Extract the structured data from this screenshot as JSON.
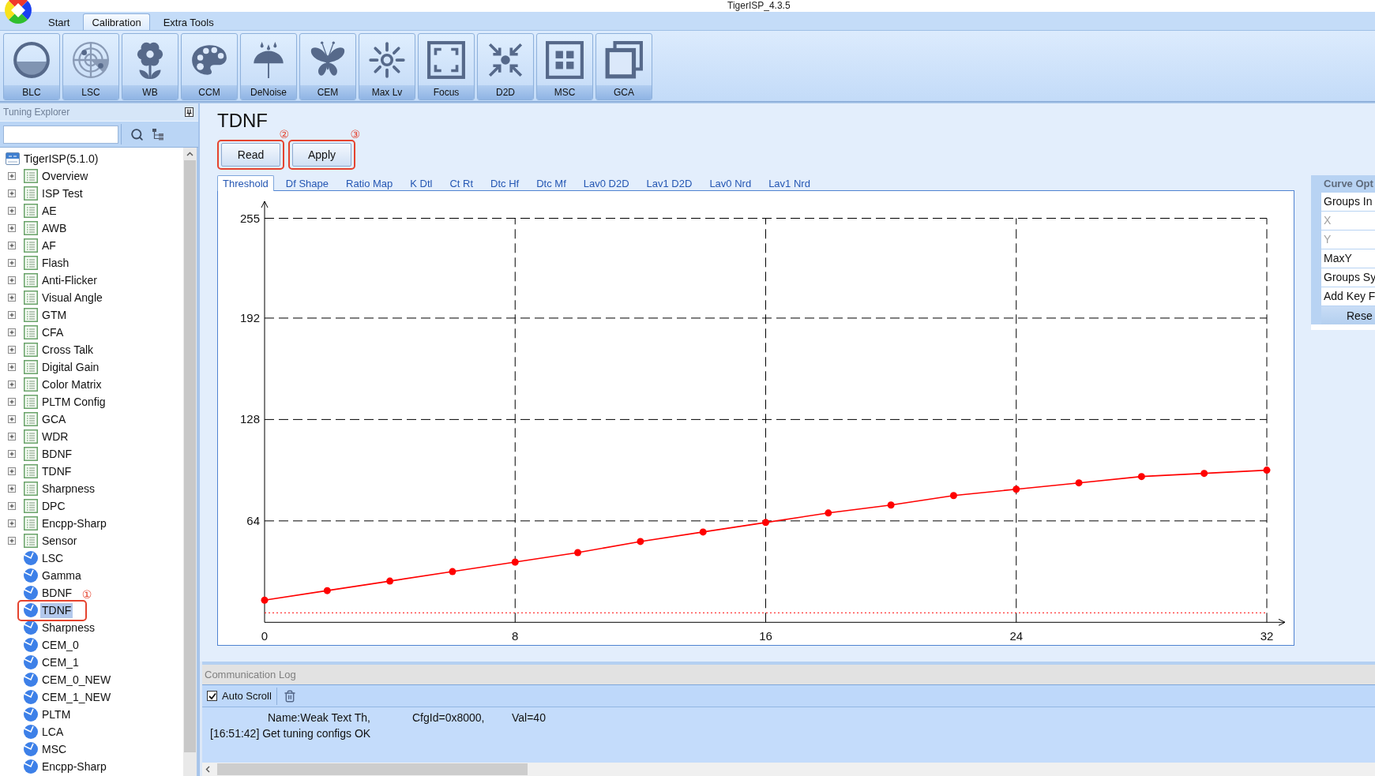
{
  "window": {
    "title": "TigerISP_4.3.5"
  },
  "ribbon": {
    "tabs": [
      {
        "label": "Start",
        "selected": false
      },
      {
        "label": "Calibration",
        "selected": true
      },
      {
        "label": "Extra Tools",
        "selected": false
      }
    ],
    "buttons": [
      {
        "label": "BLC"
      },
      {
        "label": "LSC"
      },
      {
        "label": "WB"
      },
      {
        "label": "CCM"
      },
      {
        "label": "DeNoise"
      },
      {
        "label": "CEM"
      },
      {
        "label": "Max Lv"
      },
      {
        "label": "Focus"
      },
      {
        "label": "D2D"
      },
      {
        "label": "MSC"
      },
      {
        "label": "GCA"
      }
    ]
  },
  "explorer": {
    "title": "Tuning Explorer",
    "tree": [
      {
        "kind": "project",
        "label": "TigerISP(5.1.0)",
        "selected": false,
        "children": [
          {
            "kind": "group",
            "label": "Overview",
            "expanded": false,
            "selected": false
          },
          {
            "kind": "group",
            "label": "ISP Test",
            "expanded": false,
            "selected": false
          },
          {
            "kind": "group",
            "label": "AE",
            "expanded": false,
            "selected": false
          },
          {
            "kind": "group",
            "label": "AWB",
            "expanded": false,
            "selected": false
          },
          {
            "kind": "group",
            "label": "AF",
            "expanded": false,
            "selected": false
          },
          {
            "kind": "group",
            "label": "Flash",
            "expanded": false,
            "selected": false
          },
          {
            "kind": "group",
            "label": "Anti-Flicker",
            "expanded": false,
            "selected": false
          },
          {
            "kind": "group",
            "label": "Visual Angle",
            "expanded": false,
            "selected": false
          },
          {
            "kind": "group",
            "label": "GTM",
            "expanded": false,
            "selected": false
          },
          {
            "kind": "group",
            "label": "CFA",
            "expanded": false,
            "selected": false
          },
          {
            "kind": "group",
            "label": "Cross Talk",
            "expanded": false,
            "selected": false
          },
          {
            "kind": "group",
            "label": "Digital Gain",
            "expanded": false,
            "selected": false
          },
          {
            "kind": "group",
            "label": "Color Matrix",
            "expanded": false,
            "selected": false
          },
          {
            "kind": "group",
            "label": "PLTM Config",
            "expanded": false,
            "selected": false
          },
          {
            "kind": "group",
            "label": "GCA",
            "expanded": false,
            "selected": false
          },
          {
            "kind": "group",
            "label": "WDR",
            "expanded": false,
            "selected": false
          },
          {
            "kind": "group",
            "label": "BDNF",
            "expanded": false,
            "selected": false
          },
          {
            "kind": "group",
            "label": "TDNF",
            "expanded": false,
            "selected": false
          },
          {
            "kind": "group",
            "label": "Sharpness",
            "expanded": false,
            "selected": false
          },
          {
            "kind": "group",
            "label": "DPC",
            "expanded": false,
            "selected": false
          },
          {
            "kind": "group",
            "label": "Encpp-Sharp",
            "expanded": false,
            "selected": false
          },
          {
            "kind": "group",
            "label": "Sensor",
            "expanded": false,
            "selected": false
          },
          {
            "kind": "module",
            "label": "LSC",
            "selected": false
          },
          {
            "kind": "module",
            "label": "Gamma",
            "selected": false
          },
          {
            "kind": "module",
            "label": "BDNF",
            "selected": false
          },
          {
            "kind": "module",
            "label": "TDNF",
            "selected": true,
            "annotation": "①"
          },
          {
            "kind": "module",
            "label": "Sharpness",
            "selected": false
          },
          {
            "kind": "module",
            "label": "CEM_0",
            "selected": false
          },
          {
            "kind": "module",
            "label": "CEM_1",
            "selected": false
          },
          {
            "kind": "module",
            "label": "CEM_0_NEW",
            "selected": false
          },
          {
            "kind": "module",
            "label": "CEM_1_NEW",
            "selected": false
          },
          {
            "kind": "module",
            "label": "PLTM",
            "selected": false
          },
          {
            "kind": "module",
            "label": "LCA",
            "selected": false
          },
          {
            "kind": "module",
            "label": "MSC",
            "selected": false
          },
          {
            "kind": "module",
            "label": "Encpp-Sharp",
            "selected": false
          }
        ]
      }
    ]
  },
  "editor": {
    "title": "TDNF",
    "buttons": [
      {
        "label": "Read",
        "annotation": "②"
      },
      {
        "label": "Apply",
        "annotation": "③"
      }
    ],
    "tabs": [
      {
        "label": "Threshold",
        "selected": true
      },
      {
        "label": "Df Shape",
        "selected": false
      },
      {
        "label": "Ratio Map",
        "selected": false
      },
      {
        "label": "K Dtl",
        "selected": false
      },
      {
        "label": "Ct Rt",
        "selected": false
      },
      {
        "label": "Dtc Hf",
        "selected": false
      },
      {
        "label": "Dtc Mf",
        "selected": false
      },
      {
        "label": "Lav0 D2D",
        "selected": false
      },
      {
        "label": "Lav1 D2D",
        "selected": false
      },
      {
        "label": "Lav0 Nrd",
        "selected": false
      },
      {
        "label": "Lav1 Nrd",
        "selected": false
      }
    ],
    "chart_data": {
      "type": "line",
      "x": [
        0,
        2,
        4,
        6,
        8,
        10,
        12,
        14,
        16,
        18,
        20,
        22,
        24,
        26,
        28,
        30,
        32
      ],
      "series": [
        {
          "color": "#ff0000",
          "marker": "circle",
          "values": [
            14,
            20,
            26,
            32,
            38,
            44,
            51,
            57,
            63,
            69,
            74,
            80,
            84,
            88,
            92,
            94,
            96
          ]
        }
      ],
      "xlim": [
        0,
        32
      ],
      "ylim": [
        0,
        255
      ],
      "xticks": [
        0,
        8,
        16,
        24,
        32
      ],
      "yticks": [
        64,
        128,
        192,
        255
      ],
      "grid": true,
      "ref_lines": [
        {
          "axis": "y",
          "value": 6,
          "color": "#ff0000"
        }
      ]
    }
  },
  "curve_options": {
    "title": "Curve Opt",
    "rows": [
      {
        "label": "Groups In",
        "disabled": false
      },
      {
        "label": "X",
        "disabled": true
      },
      {
        "label": "Y",
        "disabled": true
      },
      {
        "label": "MaxY",
        "disabled": false
      },
      {
        "label": "Groups Sy",
        "disabled": false
      },
      {
        "label": "Add Key F",
        "disabled": false
      }
    ],
    "button": "Rese"
  },
  "communication_log": {
    "title": "Communication Log",
    "auto_scroll": {
      "label": "Auto Scroll",
      "checked": true
    },
    "lines": [
      {
        "kind": "detail",
        "cells": [
          "Name:Weak Text Th,",
          "CfgId=0x8000,",
          "Val=40"
        ]
      },
      {
        "kind": "entry",
        "cells": [
          "[16:51:42] Get tuning configs OK"
        ]
      }
    ]
  }
}
